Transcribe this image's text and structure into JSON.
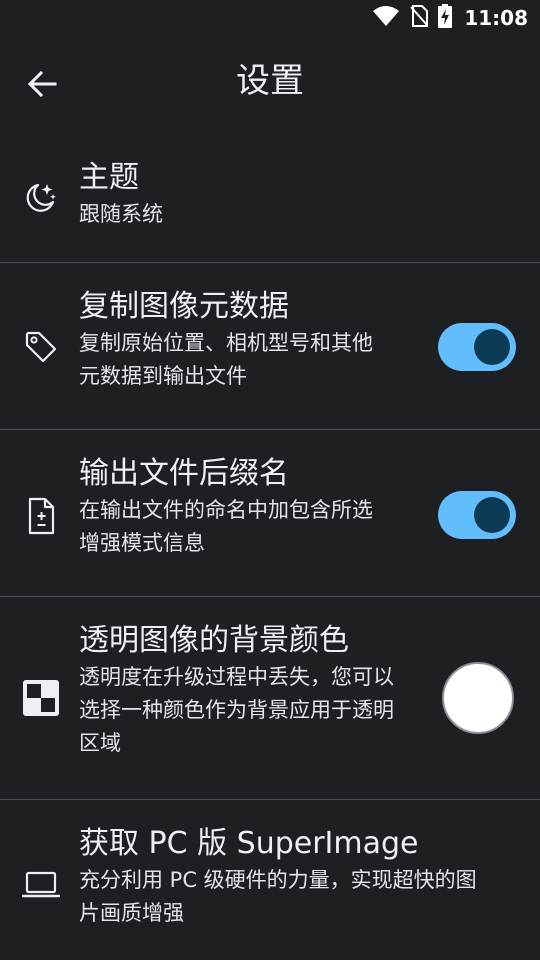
{
  "status_bar": {
    "time": "11:08",
    "icons": [
      "wifi-icon",
      "no-sim-icon",
      "battery-charging-icon"
    ]
  },
  "app_bar": {
    "title": "设置",
    "back_icon": "arrow-back-icon"
  },
  "settings": [
    {
      "id": "theme",
      "icon": "moon-stars-icon",
      "title": "主题",
      "description_lines": [
        "跟随系统"
      ],
      "control": "none"
    },
    {
      "id": "copy-metadata",
      "icon": "tag-icon",
      "title": "复制图像元数据",
      "description_lines": [
        "复制原始位置、相机型号和其他",
        "元数据到输出文件"
      ],
      "control": "toggle",
      "enabled": true
    },
    {
      "id": "output-suffix",
      "icon": "file-plus-minus-icon",
      "title": "输出文件后缀名",
      "description_lines": [
        "在输出文件的命名中加包含所选",
        "增强模式信息"
      ],
      "control": "toggle",
      "enabled": true
    },
    {
      "id": "transparent-bg",
      "icon": "checkerboard-icon",
      "title": "透明图像的背景颜色",
      "description_lines": [
        "透明度在升级过程中丢失，您可以",
        "选择一种颜色作为背景应用于透明",
        "区域"
      ],
      "control": "color",
      "color": "#ffffff"
    },
    {
      "id": "get-pc",
      "icon": "laptop-icon",
      "title": "获取 PC 版 SuperImage",
      "description_lines": [
        "充分利用 PC 级硬件的力量，实现超快的图",
        "片画质增强"
      ],
      "control": "none"
    }
  ],
  "colors": {
    "background": "#1d1f23",
    "divider": "#4a4e55",
    "toggle_track": "#62bdfc",
    "toggle_knob": "#0c3c55"
  }
}
